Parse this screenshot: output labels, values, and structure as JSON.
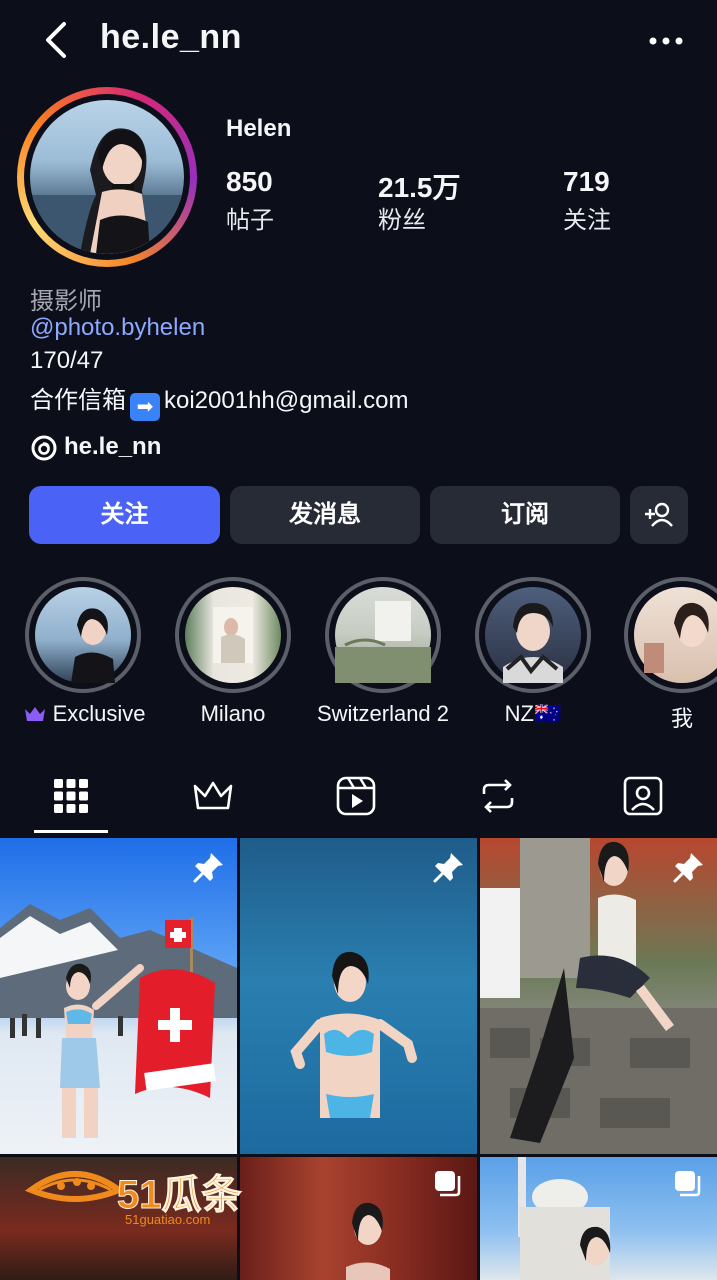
{
  "header": {
    "username": "he.le_nn",
    "back_icon": "chevron-left-icon",
    "more_icon": "more-horizontal-icon"
  },
  "profile": {
    "display_name": "Helen",
    "stats": [
      {
        "value": "850",
        "label": "帖子"
      },
      {
        "value": "21.5万",
        "label": "粉丝"
      },
      {
        "value": "719",
        "label": "关注"
      }
    ],
    "bio": {
      "title": "摄影师",
      "link": "@photo.byhelen",
      "line": "170/47",
      "mail_prefix": "合作信箱",
      "mail_emoji": "➡",
      "mail": "koi2001hh@gmail.com"
    },
    "threads_handle": "he.le_nn"
  },
  "actions": {
    "follow": "关注",
    "message": "发消息",
    "subscribe": "订阅",
    "add_user_icon": "add-person-icon"
  },
  "highlights": [
    {
      "label": "Exclusive",
      "badge_icon": "crown-icon"
    },
    {
      "label": "Milano"
    },
    {
      "label": "Switzerland 2"
    },
    {
      "label": "NZ🇦🇺"
    },
    {
      "label": "我"
    }
  ],
  "tabs": [
    {
      "icon": "grid-icon",
      "active": true
    },
    {
      "icon": "crown-icon",
      "active": false
    },
    {
      "icon": "reels-icon",
      "active": false
    },
    {
      "icon": "repost-icon",
      "active": false
    },
    {
      "icon": "tagged-icon",
      "active": false
    }
  ],
  "posts": [
    {
      "pinned": true
    },
    {
      "pinned": true
    },
    {
      "pinned": true
    },
    {
      "multi": false
    },
    {
      "multi": true
    },
    {
      "multi": true
    }
  ],
  "watermark": {
    "brand": "51瓜条",
    "url": "51guatiao.com"
  },
  "colors": {
    "background": "#0c0f1a",
    "primary_button": "#4a62f5",
    "secondary_button": "#272b36",
    "link": "#8ea7ff"
  }
}
